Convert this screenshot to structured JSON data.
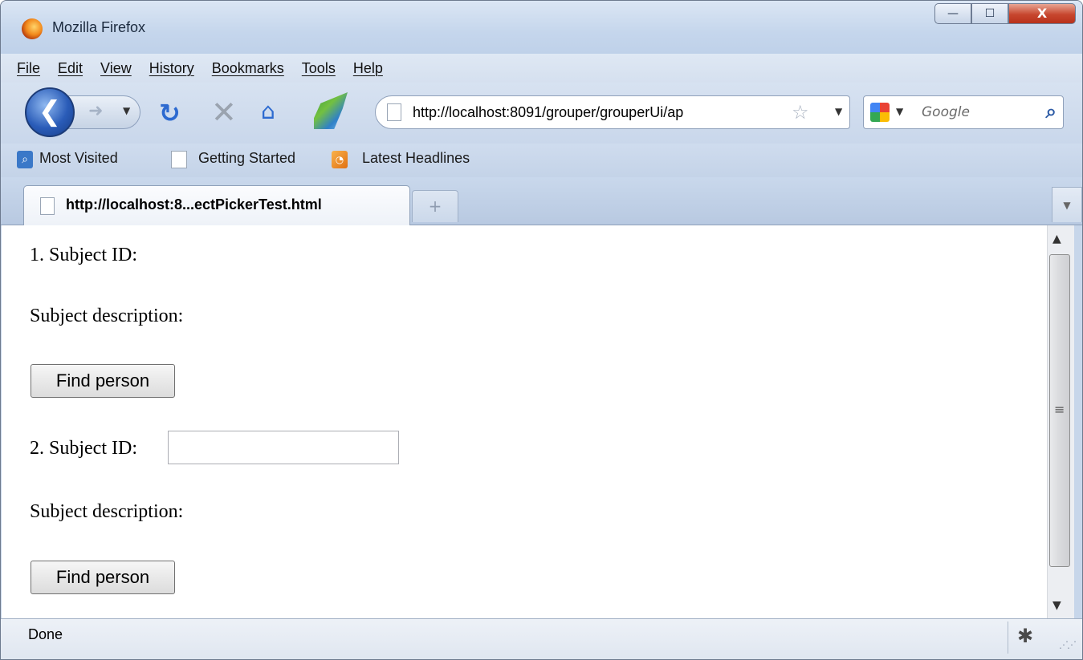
{
  "window": {
    "title": "Mozilla Firefox",
    "controls": {
      "minimize": "—",
      "maximize": "☐",
      "close": "X"
    }
  },
  "menu": [
    "File",
    "Edit",
    "View",
    "History",
    "Bookmarks",
    "Tools",
    "Help"
  ],
  "navbar": {
    "url": "http://localhost:8091/grouper/grouperUi/ap",
    "search_placeholder": "Google"
  },
  "bookmarks": [
    "Most Visited",
    "Getting Started",
    "Latest Headlines"
  ],
  "tab": {
    "label": "http://localhost:8...ectPickerTest.html"
  },
  "content": {
    "subject1_label": "1. Subject ID:",
    "description1_label": "Subject description:",
    "find_button1": "Find person",
    "subject2_label": "2. Subject ID:",
    "subject2_value": "",
    "description2_label": "Subject description:",
    "find_button2": "Find person"
  },
  "status": {
    "text": "Done"
  },
  "colors": {
    "accent": "#2d6ad0",
    "close_button": "#c7462e"
  },
  "icons": [
    "firefox-icon",
    "back-icon",
    "forward-icon",
    "reload-icon",
    "stop-icon",
    "home-icon",
    "star-icon",
    "search-icon",
    "rss-icon",
    "bug-icon"
  ]
}
